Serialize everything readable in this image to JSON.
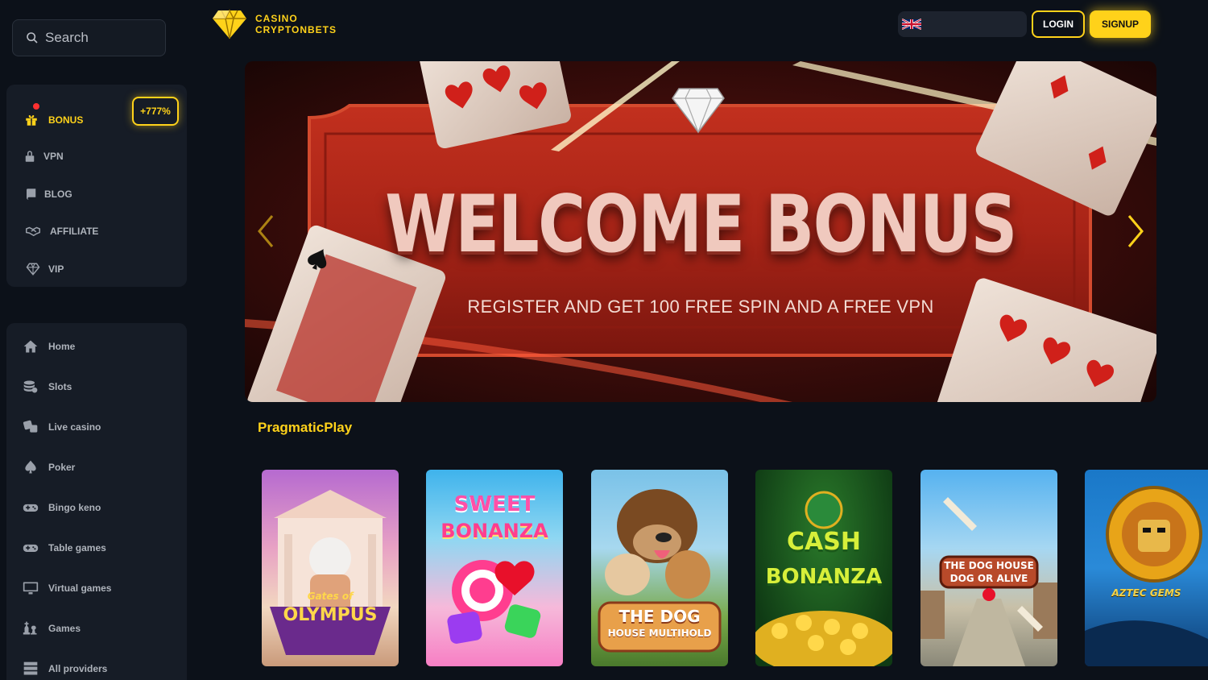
{
  "search": {
    "placeholder": "Search"
  },
  "sidebar": {
    "top": [
      {
        "label": "BONUS",
        "icon": "gift-icon",
        "badge": "+777%"
      },
      {
        "label": "VPN",
        "icon": "lock-icon"
      },
      {
        "label": "BLOG",
        "icon": "book-icon"
      },
      {
        "label": "AFFILIATE",
        "icon": "handshake-icon"
      },
      {
        "label": "VIP",
        "icon": "diamond-icon"
      }
    ],
    "nav": [
      {
        "label": "Home",
        "icon": "home-icon"
      },
      {
        "label": "Slots",
        "icon": "coins-icon"
      },
      {
        "label": "Live casino",
        "icon": "dice-icon"
      },
      {
        "label": "Poker",
        "icon": "spade-icon"
      },
      {
        "label": "Bingo keno",
        "icon": "gamepad-icon"
      },
      {
        "label": "Table games",
        "icon": "gamepad-icon"
      },
      {
        "label": "Virtual games",
        "icon": "monitor-icon"
      },
      {
        "label": "Games",
        "icon": "chess-icon"
      },
      {
        "label": "All providers",
        "icon": "server-icon"
      }
    ]
  },
  "header": {
    "logo_line1": "CASINO",
    "logo_line2": "CRYPTONBETS",
    "language": "uk-flag-icon",
    "login": "LOGIN",
    "signup": "SIGNUP"
  },
  "banner": {
    "title": "WELCOME BONUS",
    "subtitle": "REGISTER AND GET 100 FREE SPIN AND A FREE VPN"
  },
  "provider": {
    "name": "PragmaticPlay",
    "games": [
      {
        "title_line1": "Gates of",
        "title_line2": "OLYMPUS"
      },
      {
        "title_line1": "SWEET",
        "title_line2": "BONANZA"
      },
      {
        "title_line1": "THE DOG",
        "title_line2": "HOUSE MULTIHOLD"
      },
      {
        "title_line1": "CASH",
        "title_line2": "BONANZA"
      },
      {
        "title_line1": "THE DOG HOUSE",
        "title_line2": "DOG OR ALIVE"
      },
      {
        "title_line1": "AZTEC GEMS",
        "title_line2": ""
      }
    ]
  },
  "colors": {
    "accent": "#ffd21a",
    "background": "#0c1119",
    "panel": "#161c26"
  }
}
